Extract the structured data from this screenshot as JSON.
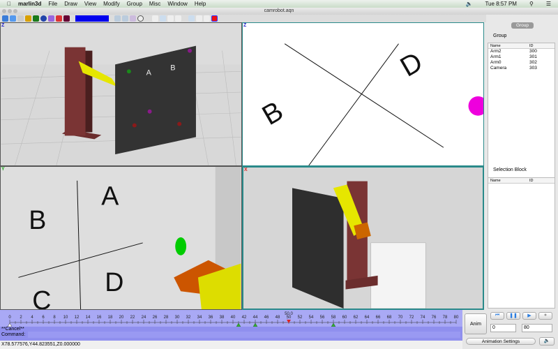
{
  "menubar": {
    "app": "marlin3d",
    "items": [
      "File",
      "Draw",
      "View",
      "Modify",
      "Group",
      "Misc",
      "Window",
      "Help"
    ],
    "clock": "Tue 8:57 PM"
  },
  "window": {
    "title": "camrobot.aqn"
  },
  "viewports": {
    "top_left": "Z",
    "top_right": "Z",
    "bottom_left": "Y",
    "bottom_right": "X"
  },
  "scene_labels": [
    "A",
    "B",
    "C",
    "D"
  ],
  "right_panel": {
    "tab": "Group",
    "group_title": "Group",
    "columns": [
      "Name",
      "ID"
    ],
    "rows": [
      {
        "name": "Arm2",
        "id": "300"
      },
      {
        "name": "Arm1",
        "id": "301"
      },
      {
        "name": "Arm0",
        "id": "302"
      },
      {
        "name": "Camera",
        "id": "303"
      }
    ],
    "selection_title": "Selection Block",
    "selection_columns": [
      "Name",
      "ID"
    ]
  },
  "timeline": {
    "ticks": [
      "0",
      "2",
      "4",
      "6",
      "8",
      "10",
      "12",
      "14",
      "16",
      "18",
      "20",
      "22",
      "24",
      "26",
      "28",
      "30",
      "32",
      "34",
      "36",
      "38",
      "40",
      "42",
      "44",
      "46",
      "48",
      "50",
      "52",
      "54",
      "56",
      "58",
      "60",
      "62",
      "64",
      "66",
      "68",
      "70",
      "72",
      "74",
      "76",
      "78",
      "80"
    ],
    "current": "50.0",
    "keyframes": [
      41,
      44,
      58
    ],
    "cancel": "**Cancel**",
    "command_label": "Command:"
  },
  "status": "X78.577576,Y44.823551,Z0.000000",
  "anim": {
    "anim_label": "Anim",
    "start": "0",
    "end": "80",
    "settings_label": "Animation Settings"
  }
}
